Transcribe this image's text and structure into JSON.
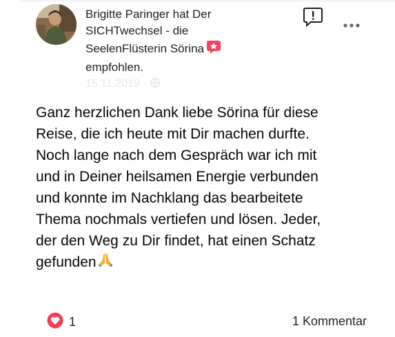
{
  "post": {
    "header_lines": [
      "Brigitte Paringer hat Der",
      "SICHTwechsel - die",
      "SeelenFlüsterin Sörina",
      "empfohlen."
    ],
    "date": "15.11.2019 · ",
    "body_lines": [
      "Ganz herzlichen Dank liebe Sörina für diese",
      "Reise, die ich heute mit Dir machen durfte.",
      "Noch lange nach dem Gespräch war ich mit",
      "und in Deiner heilsamen Energie verbunden",
      "und konnte im Nachklang das bearbeitete",
      "Thema nochmals vertiefen und lösen. Jeder,",
      "der den Weg zu Dir findet, hat einen Schatz",
      "gefunden"
    ],
    "reaction_count": "1",
    "comment_label": "1 Kommentar"
  },
  "icons": {
    "avatar": "profile-photo",
    "recommendation": "star-speech-bubble-icon",
    "report": "exclamation-bubble-icon",
    "more": "three-dots-icon",
    "reaction": "heart-icon",
    "emoji": "folded-hands-emoji",
    "privacy": "globe-icon"
  },
  "colors": {
    "heart": "#f33e58",
    "recommend_badge": "#f3425f",
    "text": "#050505"
  }
}
